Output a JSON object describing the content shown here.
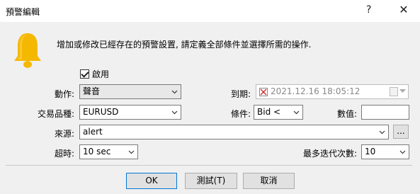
{
  "window": {
    "title": "預警編輯",
    "help_glyph": "?",
    "close_glyph": "✕"
  },
  "description": "增加或修改已經存在的預警設置, 請定義全部條件並選擇所需的操作.",
  "enable": {
    "label": "啟用",
    "checked": true
  },
  "action": {
    "label": "動作:",
    "value": "聲音"
  },
  "expiry": {
    "label": "到期:",
    "value": "2021.12.16 18:05:12"
  },
  "symbol": {
    "label": "交易品種:",
    "value": "EURUSD"
  },
  "condition": {
    "label": "條件:",
    "value": "Bid <"
  },
  "value_field": {
    "label": "數值:",
    "value": ""
  },
  "source": {
    "label": "來源:",
    "value": "alert",
    "browse_label": "..."
  },
  "timeout": {
    "label": "超時:",
    "value": "10 sec"
  },
  "max_iterations": {
    "label": "最多迭代次數:",
    "value": "10"
  },
  "buttons": {
    "ok": "OK",
    "test": "測試(T)",
    "cancel": "取消"
  },
  "colors": {
    "bell": "#f5b800",
    "focus_border": "#0078d7"
  }
}
